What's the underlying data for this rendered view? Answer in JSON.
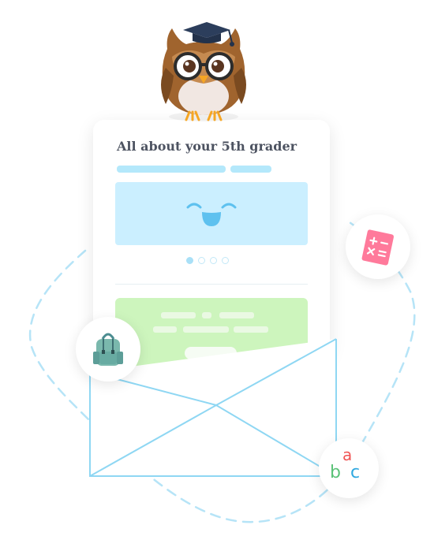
{
  "card": {
    "title": "All about your 5th grader"
  },
  "badges": {
    "math_symbols": [
      "+",
      "−",
      "×",
      "="
    ],
    "abc_letters": [
      "a",
      "b",
      "c"
    ]
  },
  "carousel": {
    "total_dots": 4,
    "active_index": 0
  },
  "colors": {
    "title_text": "#4d5361",
    "light_blue": "#b4e8fb",
    "face_panel": "#cbefff",
    "green_panel": "#cdf5bd",
    "peach_panel": "#ffd6b0",
    "math_badge": "#ff7a9b",
    "letter_a": "#f05454",
    "letter_b": "#5cc279",
    "letter_c": "#2fa8e0"
  }
}
